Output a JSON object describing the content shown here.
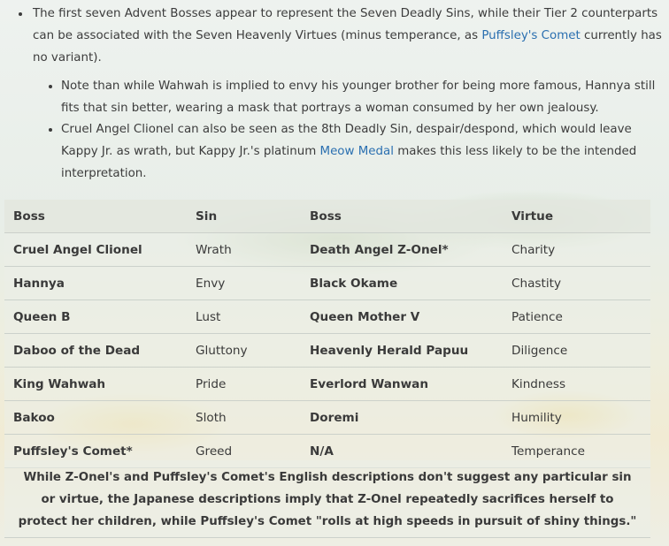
{
  "notes": {
    "main_before": "The first seven Advent Bosses appear to represent the Seven Deadly Sins, while their Tier 2 counterparts can be associated with the Seven Heavenly Virtues (minus temperance, as ",
    "main_link": "Puffsley's Comet",
    "main_after": " currently has no variant).",
    "sub1": "Note than while Wahwah is implied to envy his younger brother for being more famous, Hannya still fits that sin better, wearing a mask that portrays a woman consumed by her own jealousy.",
    "sub2_before": "Cruel Angel Clionel can also be seen as the 8th Deadly Sin, despair/despond, which would leave Kappy Jr. as wrath, but Kappy Jr.'s platinum ",
    "sub2_link": "Meow Medal",
    "sub2_after": " makes this less likely to be the intended interpretation."
  },
  "table": {
    "headers": [
      "Boss",
      "Sin",
      "Boss",
      "Virtue"
    ],
    "rows": [
      [
        "Cruel Angel Clionel",
        "Wrath",
        "Death Angel Z-Onel*",
        "Charity"
      ],
      [
        "Hannya",
        "Envy",
        "Black Okame",
        "Chastity"
      ],
      [
        "Queen B",
        "Lust",
        "Queen Mother V",
        "Patience"
      ],
      [
        "Daboo of the Dead",
        "Gluttony",
        "Heavenly Herald Papuu",
        "Diligence"
      ],
      [
        "King Wahwah",
        "Pride",
        "Everlord Wanwan",
        "Kindness"
      ],
      [
        "Bakoo",
        "Sloth",
        "Doremi",
        "Humility"
      ],
      [
        "Puffsley's Comet*",
        "Greed",
        "N/A",
        "Temperance"
      ]
    ],
    "footnote": "While Z-Onel's and Puffsley's Comet's English descriptions don't suggest any particular sin or virtue, the Japanese descriptions imply that Z-Onel repeatedly sacrifices herself to protect her children, while Puffsley's Comet \"rolls at high speeds in pursuit of shiny things.\""
  },
  "colors": {
    "link": "#2a6fb0",
    "text": "#3a3a3a"
  }
}
